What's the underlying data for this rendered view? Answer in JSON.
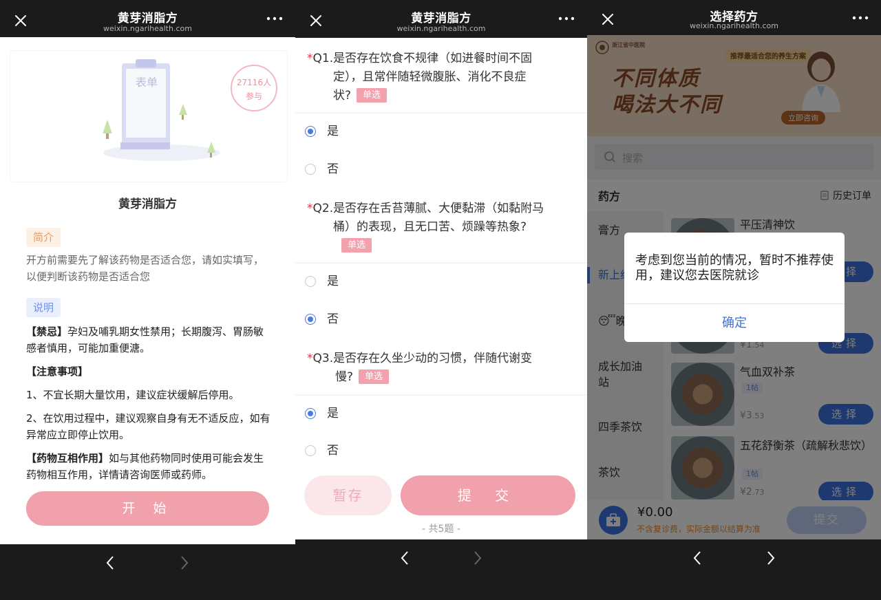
{
  "panel1": {
    "header": {
      "title": "黄芽消脂方",
      "subtitle": "weixin.ngarihealth.com"
    },
    "hero": {
      "clipboard_label": "表单",
      "count_line1": "27116人",
      "count_line2": "参与"
    },
    "title": "黄芽消脂方",
    "intro": {
      "tag": "简介",
      "text": "开方前需要先了解该药物是否适合您，请如实填写，以便判断该药物是否适合您"
    },
    "note": {
      "tag": "说明",
      "contra_head": "【禁忌】",
      "contra_text": "孕妇及哺乳期女性禁用；长期腹泻、胃肠敏感者慎用，可能加重便溏。",
      "caution_head": "【注意事项】",
      "caution_1": "1、不宜长期大量饮用，建议症状缓解后停用。",
      "caution_2": "2、在饮用过程中，建议观察自身有无不适反应，如有异常应立即停止饮用。",
      "inter_head": "【药物互相作用】",
      "inter_text": "如与其他药物同时使用可能会发生药物相互作用，详情请咨询医师或药师。"
    },
    "start_button": "开 始"
  },
  "panel2": {
    "header": {
      "title": "黄芽消脂方",
      "subtitle": "weixin.ngarihealth.com"
    },
    "questions": [
      {
        "star": "*",
        "line1": "Q1.是否存在饮食不规律（如进餐时间不固",
        "line2": "定），且常伴随轻微腹胀、消化不良症",
        "line3": "状?",
        "type": "单选",
        "options": [
          "是",
          "否"
        ],
        "selected": 0
      },
      {
        "star": "*",
        "line1": "Q2.是否存在舌苔薄腻、大便黏滞（如黏附马",
        "line2": "桶）的表现，且无口苦、烦躁等热象?",
        "type": "单选",
        "options": [
          "是",
          "否"
        ],
        "selected": 1
      },
      {
        "star": "*",
        "line1": "Q3.是否存在久坐少动的习惯，伴随代谢变",
        "line2": "慢?",
        "type": "单选",
        "options": [
          "是",
          "否"
        ],
        "selected": 0
      }
    ],
    "save_button": "暂存",
    "submit_button": "提 交",
    "total": "- 共5题 -"
  },
  "panel3": {
    "header": {
      "title": "选择药方",
      "subtitle": "weixin.ngarihealth.com"
    },
    "banner": {
      "hospital": "浙江省中医院",
      "recommend": "推荐最适合您的养生方案",
      "line1": "不同体质",
      "line2": "喝法大不同",
      "consult": "立即咨询"
    },
    "search_placeholder": "搜索",
    "section_label": "药方",
    "history": "历史订单",
    "sidebar": [
      "膏方",
      "新上线",
      "晚安",
      "成长加油站",
      "四季茶饮",
      "茶饮"
    ],
    "products": [
      {
        "name": "平压清神饮",
        "pack": "",
        "price_main": "",
        "price_dec": "",
        "button": "选择"
      },
      {
        "name": "",
        "pack": "",
        "price_main": "¥1",
        "price_dec": ".54",
        "button": "选择"
      },
      {
        "name": "气血双补茶",
        "pack": "1帖",
        "price_main": "¥3",
        "price_dec": ".53",
        "button": "选择"
      },
      {
        "name": "五花舒衡茶（疏解秋悲饮）",
        "pack": "1帖",
        "price_main": "¥2",
        "price_dec": ".73",
        "button": "选择"
      }
    ],
    "footer": {
      "sum": "¥0.00",
      "fee_note": "不含复诊费，实际金额以结算为准",
      "submit": "提交"
    },
    "dialog": {
      "message": "考虑到您当前的情况，暂时不推荐使用，建议您去医院就诊",
      "confirm": "确定"
    }
  },
  "colors": {
    "pink": "#f0a1ab",
    "blue": "#3d72e0",
    "dark": "#1b1b1b"
  }
}
